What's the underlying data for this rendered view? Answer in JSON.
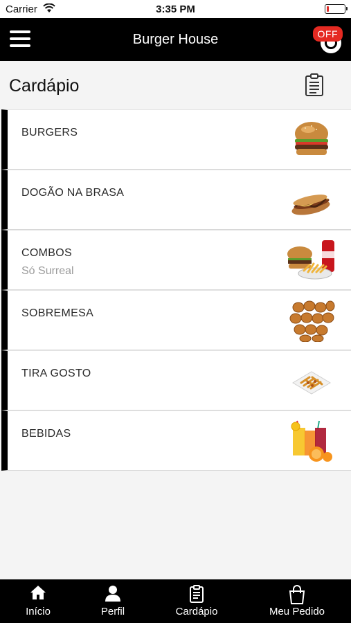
{
  "status_bar": {
    "carrier": "Carrier",
    "time": "3:35 PM"
  },
  "header": {
    "title": "Burger House",
    "status_badge": "OFF"
  },
  "section": {
    "title": "Cardápio"
  },
  "menu": {
    "items": [
      {
        "name": "BURGERS",
        "subtitle": "",
        "icon": "burger-image"
      },
      {
        "name": "DOGÃO NA BRASA",
        "subtitle": "",
        "icon": "hotdog-image"
      },
      {
        "name": "COMBOS",
        "subtitle": "Só Surreal",
        "icon": "combo-image"
      },
      {
        "name": "SOBREMESA",
        "subtitle": "",
        "icon": "dessert-image"
      },
      {
        "name": "TIRA GOSTO",
        "subtitle": "",
        "icon": "snack-image"
      },
      {
        "name": "BEBIDAS",
        "subtitle": "",
        "icon": "drinks-image"
      }
    ]
  },
  "tabs": [
    {
      "label": "Início",
      "icon": "home-icon"
    },
    {
      "label": "Perfil",
      "icon": "person-icon"
    },
    {
      "label": "Cardápio",
      "icon": "clipboard-icon"
    },
    {
      "label": "Meu Pedido",
      "icon": "shopping-bag-icon"
    }
  ],
  "colors": {
    "nav_background": "#000000",
    "badge": "#e52a22",
    "page_background": "#f4f4f4"
  }
}
